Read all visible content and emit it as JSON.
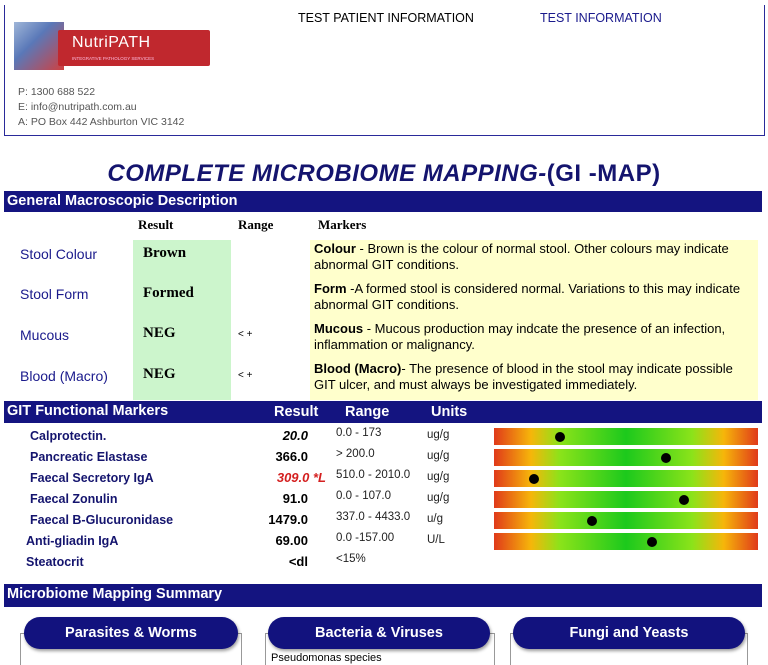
{
  "header": {
    "logo_text": "NutriPATH",
    "logo_subtext": "INTEGRATIVE PATHOLOGY SERVICES",
    "phone": "P: 1300 688 522",
    "email": "E: info@nutripath.com.au",
    "address": "A: PO Box 442 Ashburton VIC 3142",
    "patient_info_title": "TEST PATIENT INFORMATION",
    "test_info_title": "TEST INFORMATION"
  },
  "title": {
    "main": "COMPLETE MICROBIOME MAPPING-",
    "paren": "(GI -MAP)"
  },
  "macroscopic": {
    "section_title": "General Macroscopic Description",
    "col_result": "Result",
    "col_range": "Range",
    "col_markers": "Markers",
    "rows": [
      {
        "label": "Stool Colour",
        "result": "Brown",
        "range": "",
        "note_title": "Colour",
        "note_body": " -    Brown is the colour of normal stool. Other colours may indicate abnormal GIT conditions."
      },
      {
        "label": "Stool Form",
        "result": "Formed",
        "range": "",
        "note_title": "Form",
        "note_body": " -A formed stool is considered normal. Variations to this may indicate abnormal GIT conditions."
      },
      {
        "label": "Mucous",
        "result": "NEG",
        "range": "< +",
        "note_title": "Mucous",
        "note_body": " -  Mucous production may indcate the presence of an infection, inflammation or malignancy."
      },
      {
        "label": "Blood (Macro)",
        "result": "NEG",
        "range": "< +",
        "note_title": "Blood (Macro)",
        "note_body": "- The presence of blood in the stool may indicate possible GIT ulcer, and must always be investigated immediately."
      }
    ]
  },
  "git": {
    "section_title": "GIT Functional Markers",
    "col_result": "Result",
    "col_range": "Range",
    "col_units": "Units",
    "rows": [
      {
        "name": "Calprotectin.",
        "result": "20.0",
        "range": "0.0 - 173",
        "unit": "ug/g",
        "level": 0.25
      },
      {
        "name": "Pancreatic Elastase",
        "result": "366.0",
        "range": "> 200.0",
        "unit": "ug/g",
        "level": 0.65
      },
      {
        "name": "Faecal Secretory IgA",
        "result": "309.0 *L",
        "range": "510.0 - 2010.0",
        "unit": "ug/g",
        "level": 0.15
      },
      {
        "name": "Faecal Zonulin",
        "result": "91.0",
        "range": "0.0 - 107.0",
        "unit": "ug/g",
        "level": 0.72
      },
      {
        "name": "Faecal B-Glucuronidase",
        "result": "1479.0",
        "range": "337.0 - 4433.0",
        "unit": "u/g",
        "level": 0.37
      },
      {
        "name": "Anti-gliadin IgA",
        "result": "69.00",
        "range": "0.0 -157.00",
        "unit": "U/L",
        "level": 0.6
      },
      {
        "name": "Steatocrit",
        "result": "<dl",
        "range": "<15%",
        "unit": "",
        "level": null
      }
    ]
  },
  "summary": {
    "section_title": "Microbiome Mapping Summary",
    "col1": "Parasites & Worms",
    "col2": "Bacteria & Viruses",
    "col3": "Fungi and Yeasts",
    "col2_items": [
      "Pseudomonas species"
    ]
  },
  "colors": {
    "navy": "#141480",
    "result_green": "#ccf5cc",
    "note_yellow": "#ffffcc",
    "flag_red": "#d42020"
  }
}
